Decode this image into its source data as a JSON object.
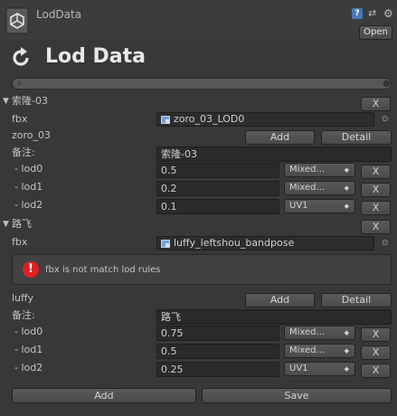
{
  "header": {
    "title": "LodData",
    "open_label": "Open"
  },
  "page_title": "Lod Data",
  "search": {
    "value": ""
  },
  "entries": [
    {
      "name": "索隆-03",
      "fbx_label": "fbx",
      "fbx_value": "zoro_03_LOD0",
      "id": "zoro_03",
      "add_label": "Add",
      "detail_label": "Detail",
      "note_label": "备注:",
      "note_value": "索隆-03",
      "lods": [
        {
          "label": "- lod0",
          "value": "0.5",
          "mode": "Mixed..."
        },
        {
          "label": "- lod1",
          "value": "0.2",
          "mode": "Mixed..."
        },
        {
          "label": "- lod2",
          "value": "0.1",
          "mode": "UV1"
        }
      ]
    },
    {
      "name": "路飞",
      "fbx_label": "fbx",
      "fbx_value": "luffy_leftshou_bandpose",
      "warning": "fbx is not match lod rules",
      "id": "luffy",
      "add_label": "Add",
      "detail_label": "Detail",
      "note_label": "备注:",
      "note_value": "路飞",
      "lods": [
        {
          "label": "- lod0",
          "value": "0.75",
          "mode": "Mixed..."
        },
        {
          "label": "- lod1",
          "value": "0.5",
          "mode": "Mixed..."
        },
        {
          "label": "- lod2",
          "value": "0.25",
          "mode": "UV1"
        }
      ]
    }
  ],
  "remove_label": "X",
  "footer": {
    "add_label": "Add",
    "save_label": "Save"
  },
  "colors": {
    "background": "#383838",
    "field": "#2a2a2a",
    "button": "#515151",
    "error": "#e02020",
    "help": "#4a78b8"
  }
}
